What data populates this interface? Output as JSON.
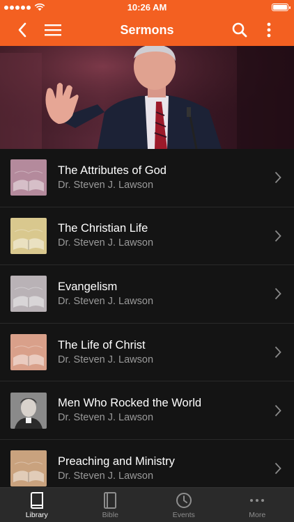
{
  "status_bar": {
    "time": "10:26 AM"
  },
  "navbar": {
    "title": "Sermons"
  },
  "sermons": [
    {
      "title": "The Attributes of God",
      "author": "Dr. Steven J. Lawson",
      "tint": "#b48a9c"
    },
    {
      "title": "The Christian Life",
      "author": "Dr. Steven J. Lawson",
      "tint": "#d9c88e"
    },
    {
      "title": "Evangelism",
      "author": "Dr. Steven J. Lawson",
      "tint": "#b9b2b6"
    },
    {
      "title": "The Life of Christ",
      "author": "Dr. Steven J. Lawson",
      "tint": "#d9a08a"
    },
    {
      "title": "Men Who Rocked the World",
      "author": "Dr. Steven J. Lawson",
      "tint": "#8a8a8a"
    },
    {
      "title": "Preaching and Ministry",
      "author": "Dr. Steven J. Lawson",
      "tint": "#c9a27e"
    }
  ],
  "tabs": [
    {
      "label": "Library",
      "icon": "book-icon",
      "active": true
    },
    {
      "label": "Bible",
      "icon": "bible-icon",
      "active": false
    },
    {
      "label": "Events",
      "icon": "clock-icon",
      "active": false
    },
    {
      "label": "More",
      "icon": "ellipsis-icon",
      "active": false
    }
  ],
  "colors": {
    "accent": "#f36021",
    "background": "#141414",
    "tabbar": "#2a2a2a"
  }
}
